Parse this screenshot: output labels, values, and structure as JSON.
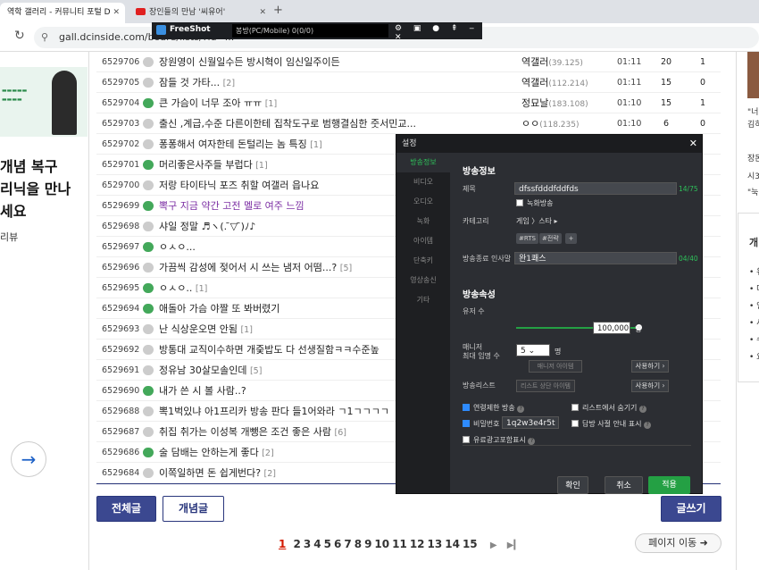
{
  "browser": {
    "tabs": [
      {
        "title": "역학 갤러리 - 커뮤니티 포털 D"
      },
      {
        "title": "장인들의 만남 '씨유어'"
      }
    ],
    "url": "gall.dcinside.com/board/lists/?id=..."
  },
  "freeshot": {
    "title": "FreeShot",
    "input": "봉방(PC/Mobile) 0(0/0)"
  },
  "left": {
    "headline": [
      "개념 복구",
      "리닉을 만나",
      "세요"
    ],
    "small": "리뷰"
  },
  "posts": [
    {
      "no": "6529706",
      "icon": "text",
      "title": "장원영이 신월일수든 방시혁이 임신일주이든",
      "count": "",
      "writer": "역갤러",
      "ip": "(39.125)",
      "date": "01:11",
      "views": "20",
      "rec": "1"
    },
    {
      "no": "6529705",
      "icon": "text",
      "title": "잠들 것 가타...",
      "count": "[2]",
      "writer": "역갤러",
      "ip": "(112.214)",
      "date": "01:11",
      "views": "15",
      "rec": "0"
    },
    {
      "no": "6529704",
      "icon": "pic",
      "title": "큰 가슴이 너무 조아 ㅠㅠ",
      "count": "[1]",
      "writer": "정묘날",
      "ip": "(183.108)",
      "date": "01:10",
      "views": "15",
      "rec": "1"
    },
    {
      "no": "6529703",
      "icon": "text",
      "title": "출신 ,계급,수준 다른이한테 집착도구로 범행결심한 줏서민교...",
      "count": "",
      "writer": "ㅇㅇ",
      "ip": "(118.235)",
      "date": "01:10",
      "views": "6",
      "rec": "0"
    },
    {
      "no": "6529702",
      "icon": "text",
      "title": "퐁퐁해서 여자한테 돈털리는 놈 특징",
      "count": "[1]",
      "writer": "",
      "ip": "",
      "date": "",
      "views": "",
      "rec": ""
    },
    {
      "no": "6529701",
      "icon": "pic",
      "title": "머리좋은사주들 부럽다",
      "count": "[1]",
      "writer": "",
      "ip": "",
      "date": "",
      "views": "",
      "rec": ""
    },
    {
      "no": "6529700",
      "icon": "text",
      "title": "저랑 타이타닉 포즈 취할 여갤러 읍나요",
      "count": "",
      "writer": "",
      "ip": "",
      "date": "",
      "views": "",
      "rec": ""
    },
    {
      "no": "6529699",
      "icon": "pic",
      "title": "뽁구 지금 약간 고전 멜로 여주 느낌",
      "count": "",
      "writer": "",
      "ip": "",
      "date": "",
      "views": "",
      "rec": "",
      "purple": true
    },
    {
      "no": "6529698",
      "icon": "text",
      "title": "샤일 정말 ♬ヽ(. ̄▽ ̄)ﾉ♪",
      "count": "",
      "writer": "",
      "ip": "",
      "date": "",
      "views": "",
      "rec": ""
    },
    {
      "no": "6529697",
      "icon": "pic",
      "title": "ㅇㅅㅇ...",
      "count": "",
      "writer": "",
      "ip": "",
      "date": "",
      "views": "",
      "rec": ""
    },
    {
      "no": "6529696",
      "icon": "text",
      "title": "가끔씩 감성에 젖어서 시 쓰는 냄저 어떰...?",
      "count": "[5]",
      "writer": "",
      "ip": "",
      "date": "",
      "views": "",
      "rec": ""
    },
    {
      "no": "6529695",
      "icon": "pic",
      "title": "ㅇㅅㅇ..",
      "count": "[1]",
      "writer": "",
      "ip": "",
      "date": "",
      "views": "",
      "rec": ""
    },
    {
      "no": "6529694",
      "icon": "pic",
      "title": "애돌아 가슴 야짤 또 봐버렸기",
      "count": "",
      "writer": "",
      "ip": "",
      "date": "",
      "views": "",
      "rec": ""
    },
    {
      "no": "6529693",
      "icon": "text",
      "title": "난 식상운오면 안됨",
      "count": "[1]",
      "writer": "",
      "ip": "",
      "date": "",
      "views": "",
      "rec": ""
    },
    {
      "no": "6529692",
      "icon": "text",
      "title": "방통대 교직이수하면 개줒밥도 다 선생질함ㅋㅋ수준높",
      "count": "",
      "writer": "",
      "ip": "",
      "date": "",
      "views": "",
      "rec": ""
    },
    {
      "no": "6529691",
      "icon": "text",
      "title": "정유남 30살모솔인데",
      "count": "[5]",
      "writer": "",
      "ip": "",
      "date": "",
      "views": "",
      "rec": ""
    },
    {
      "no": "6529690",
      "icon": "pic",
      "title": "내가 쓴 시 볼 사람..?",
      "count": "",
      "writer": "",
      "ip": "",
      "date": "",
      "views": "",
      "rec": ""
    },
    {
      "no": "6529688",
      "icon": "text",
      "title": "뽁1벅있냐 아1프리카 방송 판다 들1어와라 ㄱ1ㄱㄱㄱㄱ",
      "count": "",
      "writer": "",
      "ip": "",
      "date": "",
      "views": "",
      "rec": ""
    },
    {
      "no": "6529687",
      "icon": "text",
      "title": "취집 취가는 이성복 개뺑은 조건 좋은 사람",
      "count": "[6]",
      "writer": "",
      "ip": "",
      "date": "",
      "views": "",
      "rec": ""
    },
    {
      "no": "6529686",
      "icon": "pic",
      "title": "술 담배는 안하는게 좋다",
      "count": "[2]",
      "writer": "",
      "ip": "",
      "date": "",
      "views": "",
      "rec": ""
    },
    {
      "no": "6529684",
      "icon": "text",
      "title": "이쪽일하면 돈 쉽게번다?",
      "count": "[2]",
      "writer": "",
      "ip": "",
      "date": "",
      "views": "",
      "rec": ""
    }
  ],
  "buttons": {
    "all": "전체글",
    "best": "개념글",
    "write": "글쓰기"
  },
  "pager": {
    "current": "1",
    "pages": [
      "2",
      "3",
      "4",
      "5",
      "6",
      "7",
      "8",
      "9",
      "10",
      "11",
      "12",
      "13",
      "14",
      "15"
    ],
    "next": "▶",
    "last": "▶▎",
    "move": "페이지 이동 ➜"
  },
  "right": {
    "lines": [
      "\"너",
      "김히",
      "장돈",
      "시3",
      "\"눅"
    ],
    "box_title": "개",
    "box_items": [
      "• 유",
      "• 다",
      "• 인",
      "• 서",
      "• 수",
      "• 요"
    ]
  },
  "dialog": {
    "title": "설정",
    "close": "✕",
    "nav": [
      "방송정보",
      "비디오",
      "오디오",
      "녹화",
      "아이템",
      "단축키",
      "영상송신",
      "기타"
    ],
    "section1": "방송정보",
    "title_label": "제목",
    "title_value": "dfssfdddfddfds",
    "title_count": "14/75",
    "record_label": "녹화방송",
    "category_label": "카테고리",
    "category_value": "게임 〉스타 ▸",
    "tags": [
      "#RTS",
      "#전략"
    ],
    "tag_add": "+",
    "end_label": "방송종료 인사말",
    "end_value": "완1쾌스",
    "end_count": "04/40",
    "section2": "방송속성",
    "viewers_label": "유저 수",
    "viewers_value": "100,000",
    "viewers_unit": "명",
    "manager_label": [
      "매니저",
      "최대 임명 수"
    ],
    "manager_value": "5 ⌄",
    "manager_unit": "명",
    "manager_placeholder": "매니저 아이템",
    "use_btn": "사용하기 ›",
    "list_label": "방송리스트",
    "list_placeholder": "리스트 상단 아이템",
    "use_btn2": "사용하기 ›",
    "opt_age": "연령제한 방송",
    "opt_hide": "리스트에서 숨기기",
    "opt_pw": "비밀번호",
    "pw_value": "1q2w3e4r5t",
    "opt_guide": "답방 사절 안내 표시",
    "opt_paid": "유료광고포함표시",
    "ok": "확인",
    "cancel": "취소",
    "apply": "적용"
  }
}
